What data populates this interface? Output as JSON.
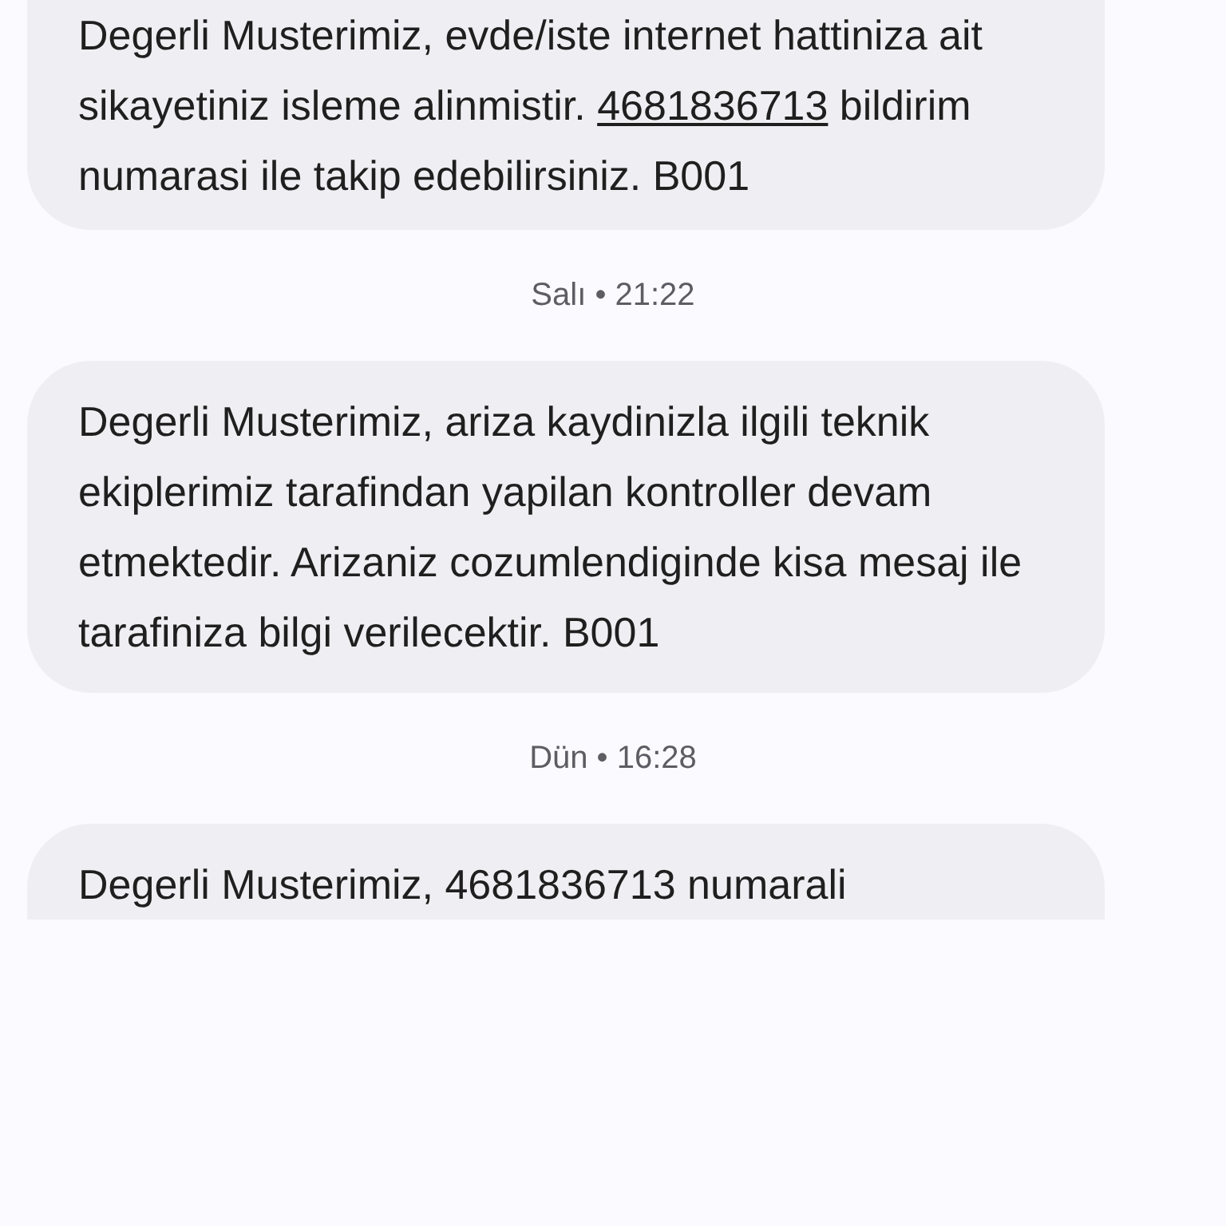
{
  "messages": [
    {
      "kind": "message",
      "parts": [
        {
          "kind": "text",
          "text": "Degerli Musterimiz, evde/iste internet hattiniza ait sikayetiniz isleme alinmistir. "
        },
        {
          "kind": "link",
          "text": "4681836713"
        },
        {
          "kind": "text",
          "text": " bildirim numarasi ile takip edebilirsiniz. B001"
        }
      ]
    },
    {
      "kind": "timestamp",
      "text": "Salı • 21:22"
    },
    {
      "kind": "message",
      "parts": [
        {
          "kind": "text",
          "text": "Degerli Musterimiz, ariza kaydinizla ilgili teknik ekiplerimiz tarafindan yapilan kontroller devam etmektedir. Arizaniz cozumlendiginde kisa mesaj ile tarafiniza bilgi verilecektir. B001"
        }
      ]
    },
    {
      "kind": "timestamp",
      "text": "Dün • 16:28"
    },
    {
      "kind": "message",
      "parts": [
        {
          "kind": "text",
          "text": "Degerli Musterimiz, 4681836713 numarali"
        }
      ]
    }
  ]
}
